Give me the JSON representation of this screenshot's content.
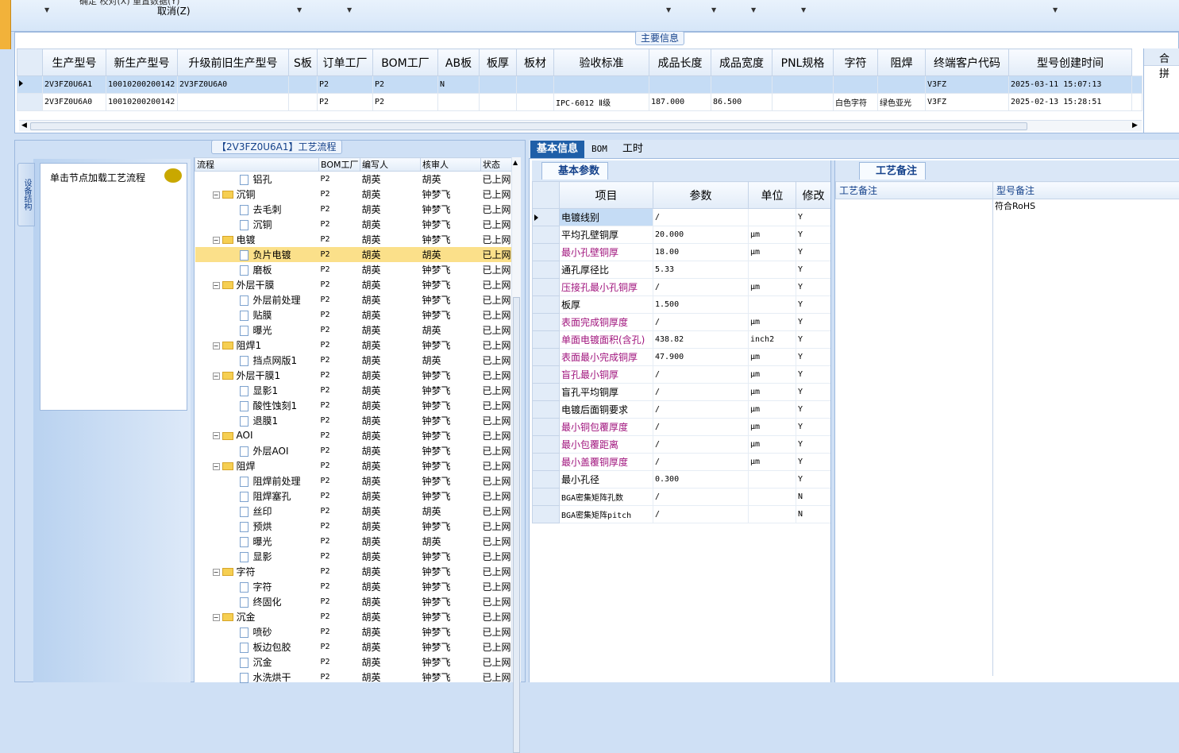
{
  "toolbar": {
    "cancel_label": "取消(Z)",
    "cut_label": "确定 校对(X)  重置数据(Y)"
  },
  "main_section": {
    "title": "主要信息",
    "columns": [
      "生产型号",
      "新生产型号",
      "升级前旧生产型号",
      "S板",
      "订单工厂",
      "BOM工厂",
      "AB板",
      "板厚",
      "板材",
      "验收标准",
      "成品长度",
      "成品宽度",
      "PNL规格",
      "字符",
      "阻焊",
      "终端客户代码",
      "型号创建时间"
    ],
    "rows": [
      {
        "cells": [
          "2V3FZ0U6A1",
          "10010200200142",
          "2V3FZ0U6A0",
          "",
          "P2",
          "P2",
          "N",
          "",
          "",
          "",
          "",
          "",
          "",
          "",
          "",
          "V3FZ",
          "2025-03-11 15:07:13"
        ],
        "selected": true
      },
      {
        "cells": [
          "2V3FZ0U6A0",
          "10010200200142",
          "",
          "",
          "P2",
          "P2",
          "",
          "",
          "",
          "IPC-6012 Ⅱ级",
          "187.000",
          "86.500",
          "",
          "白色字符",
          "绿色亚光",
          "V3FZ",
          "2025-02-13 15:28:51"
        ],
        "selected": false
      }
    ],
    "right_header": "合拼"
  },
  "process": {
    "title": "【2V3FZ0U6A1】工艺流程",
    "side_tab": "设备结构",
    "node_hint": "单击节点加载工艺流程",
    "columns": [
      "流程",
      "BOM工厂",
      "编写人",
      "核审人",
      "状态"
    ],
    "rows": [
      {
        "name": "铝孔",
        "level": 1,
        "folder": false,
        "factory": "P2",
        "writer": "胡英",
        "reviewer": "胡英",
        "status": "已上网"
      },
      {
        "name": "沉铜",
        "level": 0,
        "folder": true,
        "factory": "P2",
        "writer": "胡英",
        "reviewer": "钟梦飞",
        "status": "已上网"
      },
      {
        "name": "去毛刺",
        "level": 1,
        "folder": false,
        "factory": "P2",
        "writer": "胡英",
        "reviewer": "钟梦飞",
        "status": "已上网"
      },
      {
        "name": "沉铜",
        "level": 1,
        "folder": false,
        "factory": "P2",
        "writer": "胡英",
        "reviewer": "钟梦飞",
        "status": "已上网"
      },
      {
        "name": "电镀",
        "level": 0,
        "folder": true,
        "factory": "P2",
        "writer": "胡英",
        "reviewer": "钟梦飞",
        "status": "已上网"
      },
      {
        "name": "负片电镀",
        "level": 1,
        "folder": false,
        "factory": "P2",
        "writer": "胡英",
        "reviewer": "胡英",
        "status": "已上网",
        "selected": true
      },
      {
        "name": "磨板",
        "level": 1,
        "folder": false,
        "factory": "P2",
        "writer": "胡英",
        "reviewer": "钟梦飞",
        "status": "已上网"
      },
      {
        "name": "外层干膜",
        "level": 0,
        "folder": true,
        "factory": "P2",
        "writer": "胡英",
        "reviewer": "钟梦飞",
        "status": "已上网"
      },
      {
        "name": "外层前处理",
        "level": 1,
        "folder": false,
        "factory": "P2",
        "writer": "胡英",
        "reviewer": "钟梦飞",
        "status": "已上网"
      },
      {
        "name": "贴膜",
        "level": 1,
        "folder": false,
        "factory": "P2",
        "writer": "胡英",
        "reviewer": "钟梦飞",
        "status": "已上网"
      },
      {
        "name": "曝光",
        "level": 1,
        "folder": false,
        "factory": "P2",
        "writer": "胡英",
        "reviewer": "胡英",
        "status": "已上网"
      },
      {
        "name": "阻焊1",
        "level": 0,
        "folder": true,
        "factory": "P2",
        "writer": "胡英",
        "reviewer": "钟梦飞",
        "status": "已上网"
      },
      {
        "name": "挡点网版1",
        "level": 1,
        "folder": false,
        "factory": "P2",
        "writer": "胡英",
        "reviewer": "胡英",
        "status": "已上网"
      },
      {
        "name": "外层干膜1",
        "level": 0,
        "folder": true,
        "factory": "P2",
        "writer": "胡英",
        "reviewer": "钟梦飞",
        "status": "已上网"
      },
      {
        "name": "显影1",
        "level": 1,
        "folder": false,
        "factory": "P2",
        "writer": "胡英",
        "reviewer": "钟梦飞",
        "status": "已上网"
      },
      {
        "name": "酸性蚀刻1",
        "level": 1,
        "folder": false,
        "factory": "P2",
        "writer": "胡英",
        "reviewer": "钟梦飞",
        "status": "已上网"
      },
      {
        "name": "退膜1",
        "level": 1,
        "folder": false,
        "factory": "P2",
        "writer": "胡英",
        "reviewer": "钟梦飞",
        "status": "已上网"
      },
      {
        "name": "AOI",
        "level": 0,
        "folder": true,
        "factory": "P2",
        "writer": "胡英",
        "reviewer": "钟梦飞",
        "status": "已上网"
      },
      {
        "name": "外层AOI",
        "level": 1,
        "folder": false,
        "factory": "P2",
        "writer": "胡英",
        "reviewer": "钟梦飞",
        "status": "已上网"
      },
      {
        "name": "阻焊",
        "level": 0,
        "folder": true,
        "factory": "P2",
        "writer": "胡英",
        "reviewer": "钟梦飞",
        "status": "已上网"
      },
      {
        "name": "阻焊前处理",
        "level": 1,
        "folder": false,
        "factory": "P2",
        "writer": "胡英",
        "reviewer": "钟梦飞",
        "status": "已上网"
      },
      {
        "name": "阻焊塞孔",
        "level": 1,
        "folder": false,
        "factory": "P2",
        "writer": "胡英",
        "reviewer": "钟梦飞",
        "status": "已上网"
      },
      {
        "name": "丝印",
        "level": 1,
        "folder": false,
        "factory": "P2",
        "writer": "胡英",
        "reviewer": "胡英",
        "status": "已上网"
      },
      {
        "name": "预烘",
        "level": 1,
        "folder": false,
        "factory": "P2",
        "writer": "胡英",
        "reviewer": "钟梦飞",
        "status": "已上网"
      },
      {
        "name": "曝光",
        "level": 1,
        "folder": false,
        "factory": "P2",
        "writer": "胡英",
        "reviewer": "胡英",
        "status": "已上网"
      },
      {
        "name": "显影",
        "level": 1,
        "folder": false,
        "factory": "P2",
        "writer": "胡英",
        "reviewer": "钟梦飞",
        "status": "已上网"
      },
      {
        "name": "字符",
        "level": 0,
        "folder": true,
        "factory": "P2",
        "writer": "胡英",
        "reviewer": "钟梦飞",
        "status": "已上网"
      },
      {
        "name": "字符",
        "level": 1,
        "folder": false,
        "factory": "P2",
        "writer": "胡英",
        "reviewer": "钟梦飞",
        "status": "已上网"
      },
      {
        "name": "终固化",
        "level": 1,
        "folder": false,
        "factory": "P2",
        "writer": "胡英",
        "reviewer": "钟梦飞",
        "status": "已上网"
      },
      {
        "name": "沉金",
        "level": 0,
        "folder": true,
        "factory": "P2",
        "writer": "胡英",
        "reviewer": "钟梦飞",
        "status": "已上网"
      },
      {
        "name": "喷砂",
        "level": 1,
        "folder": false,
        "factory": "P2",
        "writer": "胡英",
        "reviewer": "钟梦飞",
        "status": "已上网"
      },
      {
        "name": "板边包胶",
        "level": 1,
        "folder": false,
        "factory": "P2",
        "writer": "胡英",
        "reviewer": "钟梦飞",
        "status": "已上网"
      },
      {
        "name": "沉金",
        "level": 1,
        "folder": false,
        "factory": "P2",
        "writer": "胡英",
        "reviewer": "钟梦飞",
        "status": "已上网"
      },
      {
        "name": "水洗烘干",
        "level": 1,
        "folder": false,
        "factory": "P2",
        "writer": "胡英",
        "reviewer": "钟梦飞",
        "status": "已上网"
      }
    ]
  },
  "detail_tabs": [
    "基本信息",
    "BOM",
    "工时"
  ],
  "params": {
    "title": "基本参数",
    "columns": [
      "项目",
      "参数",
      "单位",
      "修改"
    ],
    "rows": [
      {
        "item": "电镀线别",
        "value": "/",
        "unit": "",
        "mod": "Y",
        "purple": false,
        "selected": true
      },
      {
        "item": "平均孔壁铜厚",
        "value": "20.000",
        "unit": "μm",
        "mod": "Y",
        "purple": false
      },
      {
        "item": "最小孔壁铜厚",
        "value": "18.00",
        "unit": "μm",
        "mod": "Y",
        "purple": true
      },
      {
        "item": "通孔厚径比",
        "value": "5.33",
        "unit": "",
        "mod": "Y",
        "purple": false
      },
      {
        "item": "压接孔最小孔铜厚",
        "value": "/",
        "unit": "μm",
        "mod": "Y",
        "purple": true
      },
      {
        "item": "板厚",
        "value": "1.500",
        "unit": "",
        "mod": "Y",
        "purple": false
      },
      {
        "item": "表面完成铜厚度",
        "value": "/",
        "unit": "μm",
        "mod": "Y",
        "purple": true
      },
      {
        "item": "单面电镀面积(含孔)",
        "value": "438.82",
        "unit": "inch2",
        "mod": "Y",
        "purple": true
      },
      {
        "item": "表面最小完成铜厚",
        "value": "47.900",
        "unit": "μm",
        "mod": "Y",
        "purple": true
      },
      {
        "item": "盲孔最小铜厚",
        "value": "/",
        "unit": "μm",
        "mod": "Y",
        "purple": true
      },
      {
        "item": "盲孔平均铜厚",
        "value": "/",
        "unit": "μm",
        "mod": "Y",
        "purple": false
      },
      {
        "item": "电镀后面铜要求",
        "value": "/",
        "unit": "μm",
        "mod": "Y",
        "purple": false
      },
      {
        "item": "最小铜包覆厚度",
        "value": "/",
        "unit": "μm",
        "mod": "Y",
        "purple": true
      },
      {
        "item": "最小包覆距离",
        "value": "/",
        "unit": "μm",
        "mod": "Y",
        "purple": true
      },
      {
        "item": "最小盖覆铜厚度",
        "value": "/",
        "unit": "μm",
        "mod": "Y",
        "purple": true
      },
      {
        "item": "最小孔径",
        "value": "0.300",
        "unit": "",
        "mod": "Y",
        "purple": false
      },
      {
        "item": "BGA密集矩阵孔数",
        "value": "/",
        "unit": "",
        "mod": "N",
        "purple": false
      },
      {
        "item": "BGA密集矩阵pitch",
        "value": "/",
        "unit": "",
        "mod": "N",
        "purple": false
      }
    ]
  },
  "notes": {
    "title": "工艺备注",
    "col1": "工艺备注",
    "col2": "型号备注",
    "model_note": "符合RoHS"
  }
}
